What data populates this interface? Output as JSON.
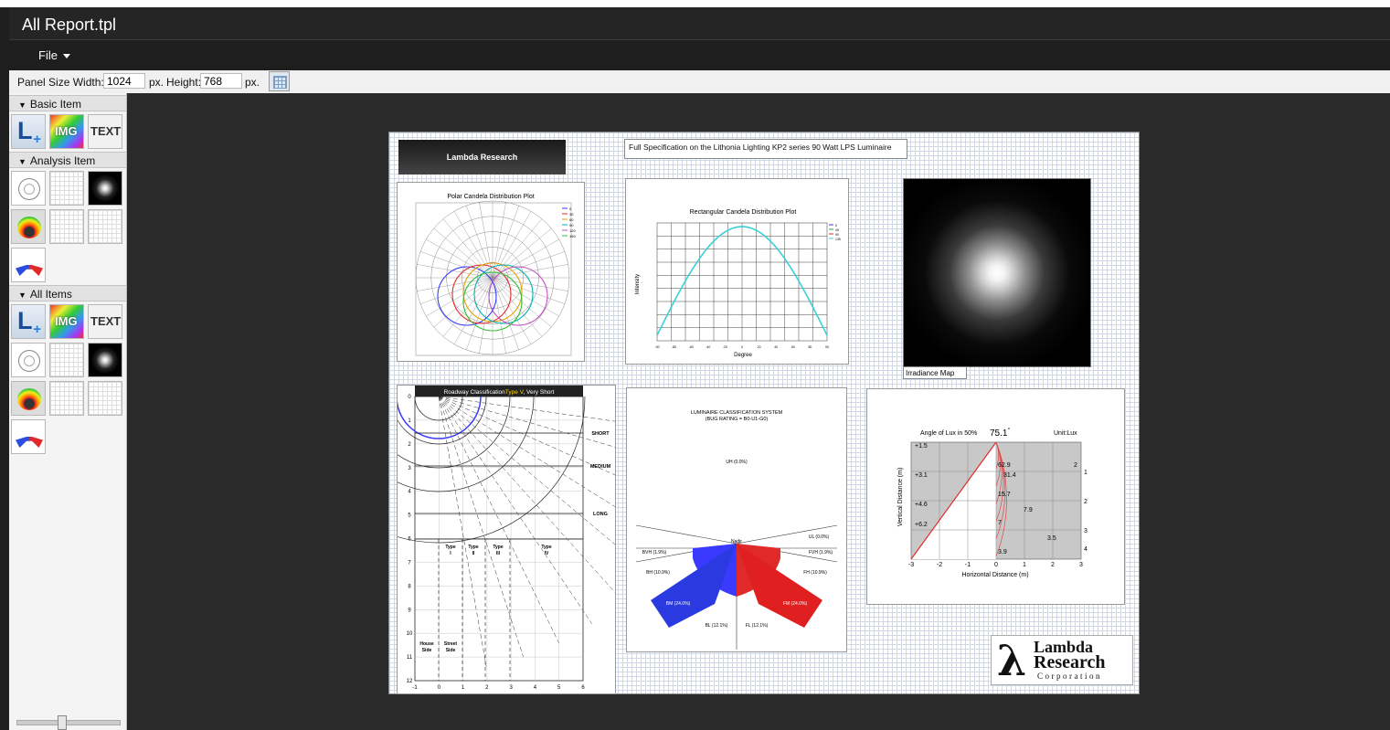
{
  "window": {
    "title": "All Report.tpl"
  },
  "menu": {
    "file_label": "File"
  },
  "panel_size": {
    "width_label": "Panel Size Width:",
    "width_value": "1024",
    "px1": "px.",
    "height_label": "Height:",
    "height_value": "768",
    "px2": "px."
  },
  "sidebar": {
    "sections": [
      {
        "label": "Basic Item"
      },
      {
        "label": "Analysis Item"
      },
      {
        "label": "All Items"
      }
    ],
    "tiles": {
      "l_label": "L",
      "img_label": "IMG",
      "text_label": "TEXT"
    }
  },
  "report": {
    "banner": "Lambda Research",
    "spec_text": "Full Specification on the Lithonia Lighting KP2 series 90 Watt LPS Luminaire",
    "irradiance_label": "Irradiance Map",
    "polar": {
      "title": "Polar Candela Distribution Plot",
      "legend": [
        "0",
        "30",
        "60",
        "90",
        "120",
        "150"
      ]
    },
    "rect": {
      "title": "Rectangular Candela Distribution Plot",
      "ylabel": "Intensity",
      "xlabel": "Degree",
      "legend": [
        "0",
        "45",
        "90",
        "135"
      ],
      "x_ticks": [
        "-90",
        "-80",
        "-60",
        "-40",
        "-20",
        "0",
        "20",
        "40",
        "60",
        "80",
        "90"
      ]
    },
    "roadway": {
      "title_prefix": "Roadway Classification",
      "title_type": "Type V",
      "title_suffix": ", Very Short",
      "y_ticks": [
        "0",
        "1",
        "2",
        "3",
        "4",
        "5",
        "6",
        "7",
        "8",
        "9",
        "10",
        "11",
        "12"
      ],
      "x_ticks": [
        "-1",
        "0",
        "1",
        "2",
        "3",
        "4",
        "5",
        "6"
      ],
      "zones": [
        "SHORT",
        "MEDIUM",
        "LONG"
      ],
      "types": [
        "Type I",
        "Type II",
        "Type III",
        "Type IV"
      ],
      "sides": [
        "House Side",
        "Street Side"
      ]
    },
    "bug": {
      "title1": "LUMINAIRE CLASSIFICATION SYSTEM",
      "title2": "(BUG RATING = B0-U1-G0)",
      "uh": "UH (0.0%)",
      "ul": "UL (0.0%)",
      "fvh": "FVH (1.9%)",
      "bvh": "BVH (1.9%)",
      "bh": "BH (10.9%)",
      "fh": "FH (10.9%)",
      "bm": "BM (24.0%)",
      "fm": "FM (24.0%)",
      "bl": "BL (12.1%)",
      "fl": "FL (12.1%)",
      "nadir": "Nadir"
    },
    "lux": {
      "angle_label": "Angle of Lux in 50%",
      "angle_value": "75.1",
      "unit": "Unit:Lux",
      "ylabel": "Vertical Distance (m)",
      "xlabel": "Horizontal Distance (m)",
      "left_labels": [
        "+1.5",
        "+3.1",
        "+4.6",
        "+6.2"
      ],
      "right_labels": [
        "1",
        "2",
        "3",
        "4"
      ],
      "x_ticks": [
        "-3",
        "-2",
        "-1",
        "0",
        "1",
        "2",
        "3"
      ],
      "values": [
        "62.9",
        "31.4",
        "15.7",
        "7.9",
        "7",
        "3.5",
        "3.9",
        "2"
      ]
    },
    "logo": {
      "line1": "Lambda",
      "line2": "Research",
      "line3": "Corporation",
      "symbol": "λ"
    }
  }
}
